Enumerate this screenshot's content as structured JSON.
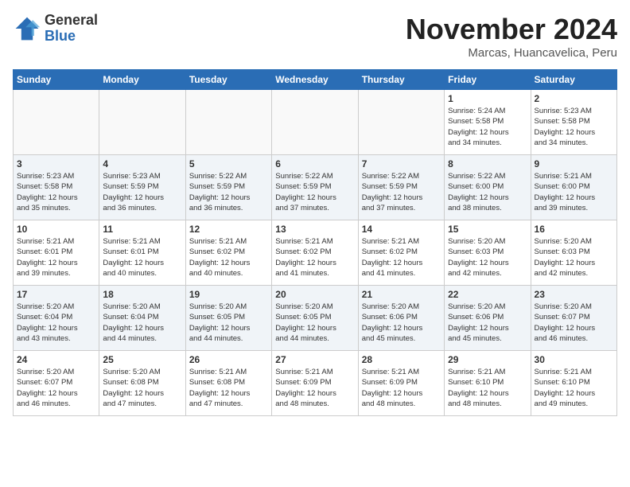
{
  "logo": {
    "general": "General",
    "blue": "Blue"
  },
  "header": {
    "month": "November 2024",
    "location": "Marcas, Huancavelica, Peru"
  },
  "weekdays": [
    "Sunday",
    "Monday",
    "Tuesday",
    "Wednesday",
    "Thursday",
    "Friday",
    "Saturday"
  ],
  "weeks": [
    [
      {
        "day": "",
        "info": ""
      },
      {
        "day": "",
        "info": ""
      },
      {
        "day": "",
        "info": ""
      },
      {
        "day": "",
        "info": ""
      },
      {
        "day": "",
        "info": ""
      },
      {
        "day": "1",
        "info": "Sunrise: 5:24 AM\nSunset: 5:58 PM\nDaylight: 12 hours\nand 34 minutes."
      },
      {
        "day": "2",
        "info": "Sunrise: 5:23 AM\nSunset: 5:58 PM\nDaylight: 12 hours\nand 34 minutes."
      }
    ],
    [
      {
        "day": "3",
        "info": "Sunrise: 5:23 AM\nSunset: 5:58 PM\nDaylight: 12 hours\nand 35 minutes."
      },
      {
        "day": "4",
        "info": "Sunrise: 5:23 AM\nSunset: 5:59 PM\nDaylight: 12 hours\nand 36 minutes."
      },
      {
        "day": "5",
        "info": "Sunrise: 5:22 AM\nSunset: 5:59 PM\nDaylight: 12 hours\nand 36 minutes."
      },
      {
        "day": "6",
        "info": "Sunrise: 5:22 AM\nSunset: 5:59 PM\nDaylight: 12 hours\nand 37 minutes."
      },
      {
        "day": "7",
        "info": "Sunrise: 5:22 AM\nSunset: 5:59 PM\nDaylight: 12 hours\nand 37 minutes."
      },
      {
        "day": "8",
        "info": "Sunrise: 5:22 AM\nSunset: 6:00 PM\nDaylight: 12 hours\nand 38 minutes."
      },
      {
        "day": "9",
        "info": "Sunrise: 5:21 AM\nSunset: 6:00 PM\nDaylight: 12 hours\nand 39 minutes."
      }
    ],
    [
      {
        "day": "10",
        "info": "Sunrise: 5:21 AM\nSunset: 6:01 PM\nDaylight: 12 hours\nand 39 minutes."
      },
      {
        "day": "11",
        "info": "Sunrise: 5:21 AM\nSunset: 6:01 PM\nDaylight: 12 hours\nand 40 minutes."
      },
      {
        "day": "12",
        "info": "Sunrise: 5:21 AM\nSunset: 6:02 PM\nDaylight: 12 hours\nand 40 minutes."
      },
      {
        "day": "13",
        "info": "Sunrise: 5:21 AM\nSunset: 6:02 PM\nDaylight: 12 hours\nand 41 minutes."
      },
      {
        "day": "14",
        "info": "Sunrise: 5:21 AM\nSunset: 6:02 PM\nDaylight: 12 hours\nand 41 minutes."
      },
      {
        "day": "15",
        "info": "Sunrise: 5:20 AM\nSunset: 6:03 PM\nDaylight: 12 hours\nand 42 minutes."
      },
      {
        "day": "16",
        "info": "Sunrise: 5:20 AM\nSunset: 6:03 PM\nDaylight: 12 hours\nand 42 minutes."
      }
    ],
    [
      {
        "day": "17",
        "info": "Sunrise: 5:20 AM\nSunset: 6:04 PM\nDaylight: 12 hours\nand 43 minutes."
      },
      {
        "day": "18",
        "info": "Sunrise: 5:20 AM\nSunset: 6:04 PM\nDaylight: 12 hours\nand 44 minutes."
      },
      {
        "day": "19",
        "info": "Sunrise: 5:20 AM\nSunset: 6:05 PM\nDaylight: 12 hours\nand 44 minutes."
      },
      {
        "day": "20",
        "info": "Sunrise: 5:20 AM\nSunset: 6:05 PM\nDaylight: 12 hours\nand 44 minutes."
      },
      {
        "day": "21",
        "info": "Sunrise: 5:20 AM\nSunset: 6:06 PM\nDaylight: 12 hours\nand 45 minutes."
      },
      {
        "day": "22",
        "info": "Sunrise: 5:20 AM\nSunset: 6:06 PM\nDaylight: 12 hours\nand 45 minutes."
      },
      {
        "day": "23",
        "info": "Sunrise: 5:20 AM\nSunset: 6:07 PM\nDaylight: 12 hours\nand 46 minutes."
      }
    ],
    [
      {
        "day": "24",
        "info": "Sunrise: 5:20 AM\nSunset: 6:07 PM\nDaylight: 12 hours\nand 46 minutes."
      },
      {
        "day": "25",
        "info": "Sunrise: 5:20 AM\nSunset: 6:08 PM\nDaylight: 12 hours\nand 47 minutes."
      },
      {
        "day": "26",
        "info": "Sunrise: 5:21 AM\nSunset: 6:08 PM\nDaylight: 12 hours\nand 47 minutes."
      },
      {
        "day": "27",
        "info": "Sunrise: 5:21 AM\nSunset: 6:09 PM\nDaylight: 12 hours\nand 48 minutes."
      },
      {
        "day": "28",
        "info": "Sunrise: 5:21 AM\nSunset: 6:09 PM\nDaylight: 12 hours\nand 48 minutes."
      },
      {
        "day": "29",
        "info": "Sunrise: 5:21 AM\nSunset: 6:10 PM\nDaylight: 12 hours\nand 48 minutes."
      },
      {
        "day": "30",
        "info": "Sunrise: 5:21 AM\nSunset: 6:10 PM\nDaylight: 12 hours\nand 49 minutes."
      }
    ]
  ]
}
